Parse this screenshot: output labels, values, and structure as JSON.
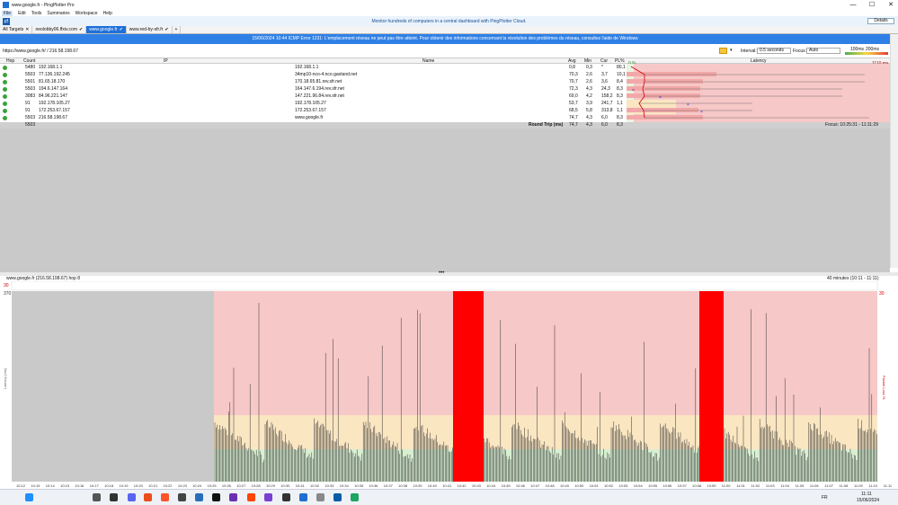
{
  "window": {
    "title": "www.google.fr - PingPlotter Pro",
    "min": "—",
    "max": "☐",
    "close": "✕"
  },
  "menu": [
    "File",
    "Edit",
    "Tools",
    "Summaries",
    "Workspace",
    "Help"
  ],
  "promo": {
    "message": "Monitor hundreds of computers in a central dashboard with PingPlotter Cloud.",
    "details_label": "Details"
  },
  "tabs": [
    {
      "label": "All Targets",
      "icon": "close-icon"
    },
    {
      "label": "neolobby06.ffxiv.com",
      "icon": "check-icon"
    },
    {
      "label": "www.google.fr",
      "icon": "check-icon",
      "selected": true
    },
    {
      "label": "www.red-by-sfr.fr",
      "icon": "check-icon"
    }
  ],
  "alert": {
    "text": "15/06/2024 10:44 ICMP Error 1231: L'emplacement réseau ne peut pas être atteint. Pour obtenir des informations concernant la résolution des problèmes du réseau, consultez l'aide de Windows"
  },
  "toolbar": {
    "target": "https://www.google.fr/ / 216.58.198.67",
    "interval_label": "Interval:",
    "interval_value": "0.5 seconds",
    "focus_label": "Focus:",
    "focus_value": "Auto",
    "legend_100": "100ms",
    "legend_200": "200ms"
  },
  "table": {
    "headers": {
      "hop": "Hop",
      "count": "Count",
      "ip": "IP",
      "name": "Name",
      "avg": "Avg",
      "min": "Min",
      "cur": "Cur",
      "pl": "PL%",
      "latency": "Latency",
      "pl_scale": "0 %",
      "lat_scale": "1110 ms"
    },
    "rows": [
      {
        "hop": "1",
        "count": "5480",
        "ip": "192.168.1.1",
        "name": "192.168.1.1",
        "avg": "0,8",
        "min": "0,3",
        "cur": "*",
        "pl": "80,1"
      },
      {
        "hop": "2",
        "count": "5503",
        "ip": "77.136.192.245",
        "name": "34mp10-nco-4.nco.gaoland.net",
        "avg": "70,3",
        "min": "2,6",
        "cur": "3,7",
        "pl": "10,1"
      },
      {
        "hop": "3",
        "count": "5501",
        "ip": "81.65.18.170",
        "name": "170.18.65.81.rev.sfr.net",
        "avg": "70,7",
        "min": "2,6",
        "cur": "3,6",
        "pl": "8,4"
      },
      {
        "hop": "4",
        "count": "5503",
        "ip": "194.6.147.164",
        "name": "164.147.6.194.rev.sfr.net",
        "avg": "72,3",
        "min": "4,3",
        "cur": "24,3",
        "pl": "8,3"
      },
      {
        "hop": "5",
        "count": "3083",
        "ip": "84.96.221.147",
        "name": "147.221.96.84.rev.sfr.net",
        "avg": "69,0",
        "min": "4,2",
        "cur": "158,2",
        "pl": "8,3"
      },
      {
        "hop": "6",
        "count": "91",
        "ip": "192.178.105.27",
        "name": "192.178.105.27",
        "avg": "53,7",
        "min": "3,9",
        "cur": "241,7",
        "pl": "1,1"
      },
      {
        "hop": "7",
        "count": "91",
        "ip": "172.253.67.157",
        "name": "172.253.67.157",
        "avg": "68,5",
        "min": "5,8",
        "cur": "313,8",
        "pl": "1,1"
      },
      {
        "hop": "8",
        "count": "5503",
        "ip": "216.58.198.67",
        "name": "www.google.fr",
        "avg": "74,7",
        "min": "4,3",
        "cur": "6,0",
        "pl": "8,3"
      }
    ],
    "summary": {
      "count": "5503",
      "label": "Round Trip (ms)",
      "avg": "74,7",
      "min": "4,3",
      "cur": "6,0",
      "pl": "8,3",
      "focus": "Focus: 10:25:31 - 11:11:29"
    }
  },
  "graph": {
    "title": "www.google.fr (216.58.198.67) hop 8",
    "duration": "40 minutes (10:11 - 11:11)",
    "pl_top": "30",
    "y_top": "370",
    "y_label": "Latency (ms)",
    "y2_label": "Packet Loss %",
    "x_ticks": [
      "10:12",
      "10:13",
      "10:14",
      "10:15",
      "10:16",
      "10:17",
      "10:18",
      "10:19",
      "10:20",
      "10:21",
      "10:22",
      "10:23",
      "10:24",
      "10:25",
      "10:26",
      "10:27",
      "10:28",
      "10:29",
      "10:30",
      "10:31",
      "10:32",
      "10:33",
      "10:34",
      "10:35",
      "10:36",
      "10:37",
      "10:38",
      "10:39",
      "10:40",
      "10:41",
      "10:42",
      "10:43",
      "10:44",
      "10:45",
      "10:46",
      "10:47",
      "10:48",
      "10:49",
      "10:50",
      "10:51",
      "10:52",
      "10:53",
      "10:54",
      "10:55",
      "10:56",
      "10:57",
      "10:58",
      "10:59",
      "11:00",
      "11:01",
      "11:02",
      "11:03",
      "11:04",
      "11:05",
      "11:06",
      "11:07",
      "11:08",
      "11:09",
      "11:10",
      "11:11"
    ]
  },
  "taskbar": {
    "lang": "FR",
    "time": "11:11",
    "date": "15/06/2024"
  },
  "colors": {
    "accent": "#2f80e6",
    "bad": "#f7c8c8",
    "warn": "#fbe6c2",
    "good": "#d8f0d2",
    "loss": "#ff0000"
  }
}
